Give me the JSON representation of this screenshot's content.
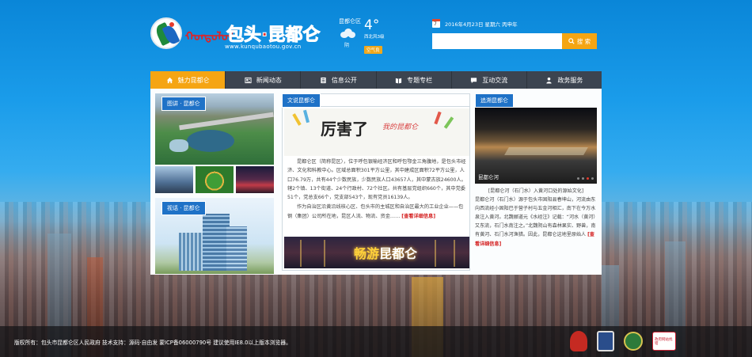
{
  "header": {
    "logo_cn": "包头·昆都仑",
    "logo_mongol": "ᠬᠤᠨᠳᠤᠯᠤᠨ",
    "logo_url": "www.kunqubaotou.gov.cn"
  },
  "weather": {
    "district": "昆都仑区",
    "temperature": "4°",
    "condition": "阴",
    "wind": "西北风3级",
    "air_quality": "空气良"
  },
  "date": {
    "cal_day": "7",
    "text": "2016年4月23日  星期六  丙申年"
  },
  "search": {
    "placeholder": "",
    "button_label": "搜 索"
  },
  "nav": {
    "items": [
      {
        "label": "魅力昆都仑",
        "icon": "home-icon"
      },
      {
        "label": "新闻动态",
        "icon": "newspaper-icon"
      },
      {
        "label": "信息公开",
        "icon": "list-icon"
      },
      {
        "label": "专题专栏",
        "icon": "book-icon"
      },
      {
        "label": "互动交流",
        "icon": "chat-icon"
      },
      {
        "label": "政务服务",
        "icon": "user-service-icon"
      }
    ]
  },
  "left_column": {
    "picture_tag": "图讲 · 昆都仑",
    "video_tag": "视话 · 昆都仑"
  },
  "middle_column": {
    "tag": "文说昆都仑",
    "banner_big": "厉害了",
    "banner_sub": "我的昆都仑",
    "paragraph1": "昆都仑区（简称昆区），位于呼包银榆经济区和呼包鄂金三角腹地，是包头市经济、文化和科教中心。区域总面积301平方公里，其中建成区面积72平方公里，人口76.79万，共有44个少数民族，少数民族人口43657人，其中蒙古族24600人。辖2个镇、13个街道、24个行政村、72个社区。共有基层党组织660个，其中党委51个，党总支66个，党支部543个，现有党员16139人。",
    "paragraph2": "作为自治区沿黄沿线核心区、包头市的主城区和自治区最大的工业企业——包钢（集团）公司所在地，昆区人流、物流、资金……",
    "more": "[查看详细信息]",
    "banner2_a": "畅游",
    "banner2_b": "昆都仑"
  },
  "right_column": {
    "tag": "追溯昆都仑",
    "image_caption": "昆都仑河",
    "story_title": "[昆都仑河（石门水）入黄河口处的源始文化]",
    "story_body": "昆都仑河（石门水）源于包头市固阳县春坤山，河流由东向西流经小固阳巴于营子村与五金河相汇，南下在今万水泉注入黄河。北魏郦道元《水经注》记载：“河水（黄河）又东流，石门水南注之。”北魏阴山有森林果实、野兽，南有黄河、石门水河渔猎。因此，昆都仑这地里原始人",
    "more": "[查看详细信息]"
  },
  "footer": {
    "copyright": "版权所有：包头市昆都仑区人民政府   技术支持：源码·自由发      蒙ICP备06000790号   建议使用IE8.0以上版本浏览器。",
    "gov_badge_text": "政府网站找错"
  },
  "colors": {
    "accent": "#f5a513",
    "tag_blue": "#1f72c7",
    "nav_bg": "#3c4450",
    "link_red": "#d31b1b"
  }
}
